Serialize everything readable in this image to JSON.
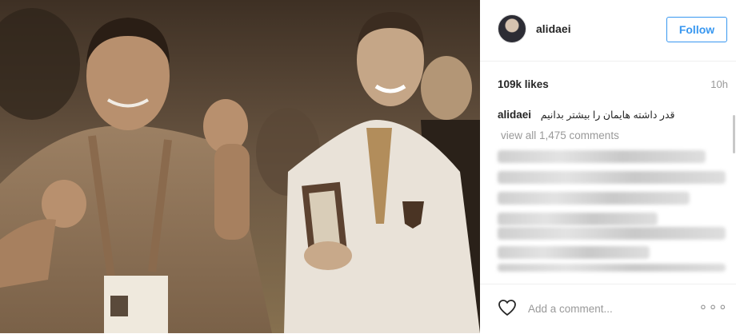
{
  "post": {
    "username": "alidaei",
    "follow_label": "Follow",
    "likes": "109k likes",
    "time_ago": "10h",
    "caption_user": "alidaei",
    "caption_text": "قدر داشته هایمان را بیشتر بدانیم",
    "view_all_comments": "view all 1,475 comments",
    "comment_placeholder": "Add a comment...",
    "more_options": "∘∘∘"
  },
  "colors": {
    "accent": "#3897f0",
    "muted_text": "#999999",
    "text": "#262626",
    "photo_sepia": "#8a7359"
  },
  "icons": [
    "heart-icon",
    "more-options-icon"
  ]
}
